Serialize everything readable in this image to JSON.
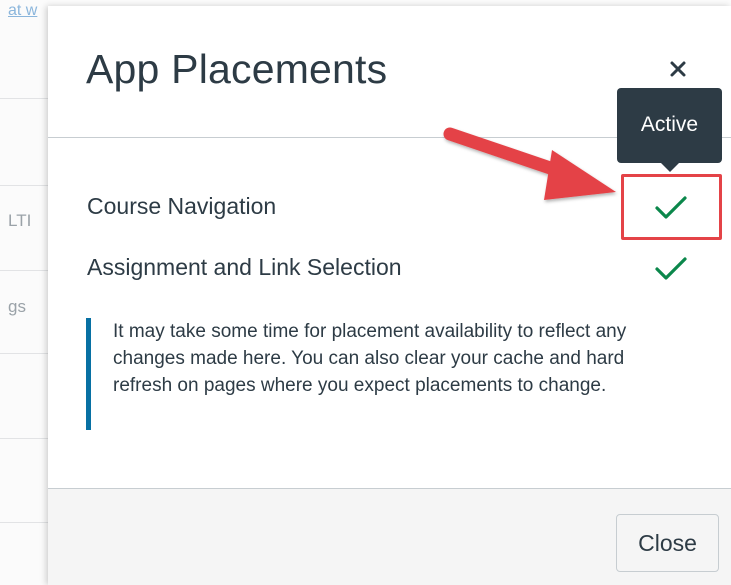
{
  "background": {
    "link_fragment": "at w",
    "fragments": [
      "LTI",
      "gs"
    ]
  },
  "modal": {
    "title": "App Placements",
    "close_icon": "close-icon",
    "placements": [
      {
        "label": "Course Navigation",
        "status_icon": "check-icon",
        "active": true
      },
      {
        "label": "Assignment and Link Selection",
        "status_icon": "check-icon",
        "active": true
      }
    ],
    "note": "It may take some time for placement availability to reflect any changes made here. You can also clear your cache and hard refresh on pages where you expect placements to change.",
    "footer": {
      "close_label": "Close"
    }
  },
  "tooltip": {
    "text": "Active"
  },
  "colors": {
    "check_green": "#0b874b",
    "text_dark": "#2d3b45",
    "note_accent": "#0770a3",
    "annotation_red": "#e44347",
    "tooltip_bg": "#2d3b45"
  }
}
